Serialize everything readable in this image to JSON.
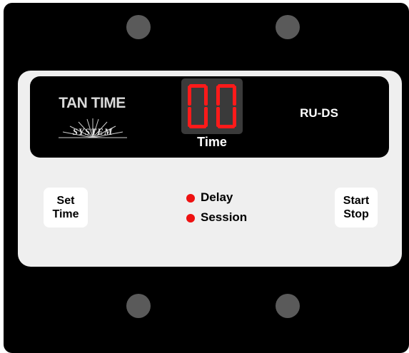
{
  "device": {
    "brand_title": "TAN TIME",
    "brand_subtitle": "SYSTEM",
    "model": "RU-DS",
    "display": {
      "digits": "00",
      "label": "Time",
      "digit_color": "#ff1a1a"
    },
    "buttons": {
      "set_time": {
        "line1": "Set",
        "line2": "Time"
      },
      "start_stop": {
        "line1": "Start",
        "line2": "Stop"
      }
    },
    "indicators": [
      {
        "label": "Delay",
        "color": "#ee1111"
      },
      {
        "label": "Session",
        "color": "#ee1111"
      }
    ]
  }
}
